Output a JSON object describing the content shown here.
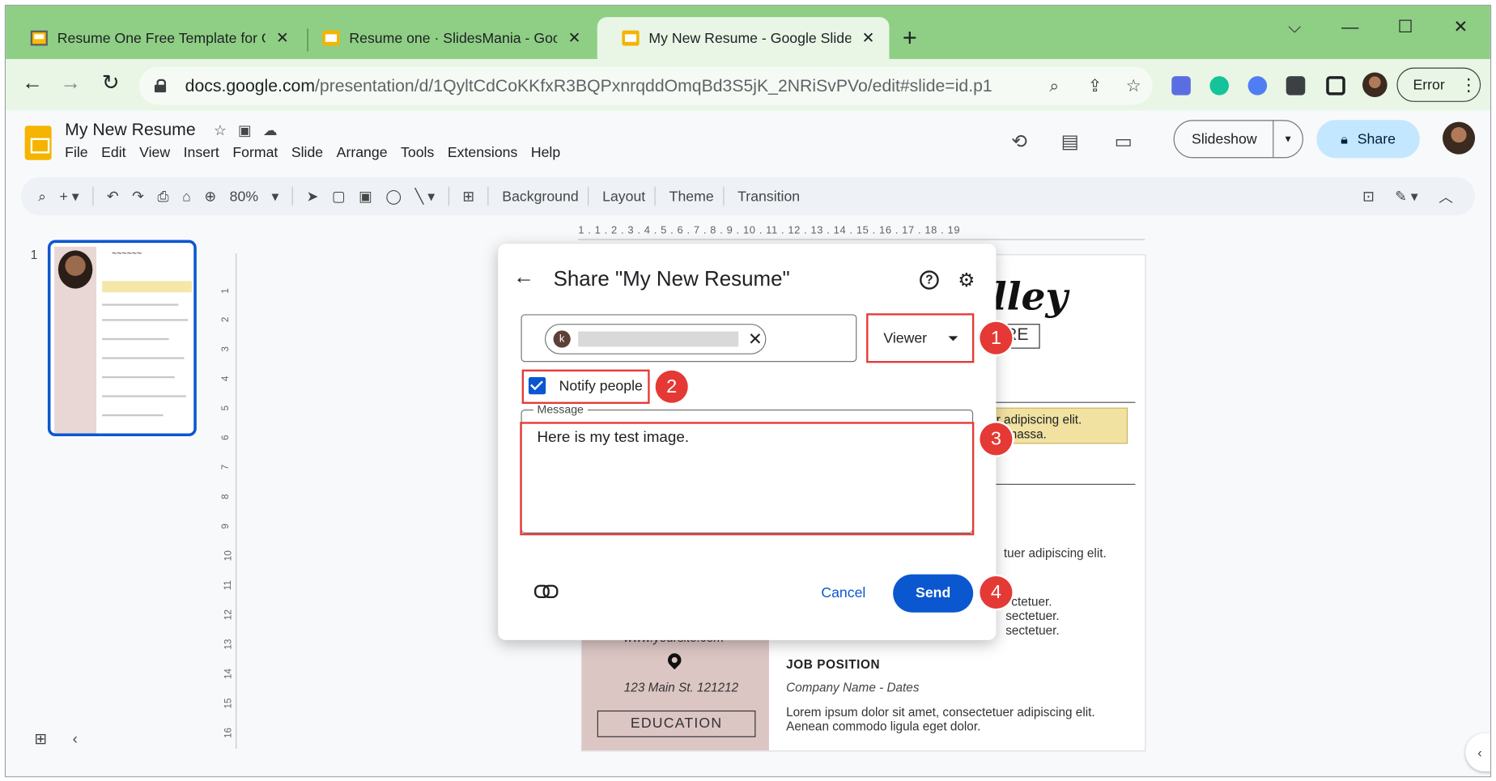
{
  "browser": {
    "tabs": [
      {
        "title": "Resume One Free Template for G",
        "close": "✕",
        "active": false
      },
      {
        "title": "Resume one · SlidesMania - Goo",
        "close": "✕",
        "active": false
      },
      {
        "title": "My New Resume - Google Slides",
        "close": "✕",
        "active": true
      }
    ],
    "new_tab": "+",
    "window_controls": {
      "dropdown": "⌵",
      "minimize": "—",
      "maximize": "☐",
      "close": "✕"
    },
    "nav": {
      "back": "←",
      "forward": "→",
      "reload": "↻"
    },
    "url_host": "docs.google.com",
    "url_path": "/presentation/d/1QyltCdCoKKfxR3BQPxnrqddOmqBd3S5jK_2NRiSvPVo/edit#slide=id.p1",
    "profile_status": "Error"
  },
  "app": {
    "title": "My New Resume",
    "menu": [
      "File",
      "Edit",
      "View",
      "Insert",
      "Format",
      "Slide",
      "Arrange",
      "Tools",
      "Extensions",
      "Help"
    ],
    "slideshow_label": "Slideshow",
    "share_label": "Share",
    "zoom": "80%",
    "toolbar_labels": [
      "Background",
      "Layout",
      "Theme",
      "Transition"
    ],
    "slide_number": "1"
  },
  "ruler": {
    "top": "1 . 1 . 2 . 3 . 4 . 5 . 6 . 7 . 8 . 9 . 10 . 11 . 12 . 13 . 14 . 15 . 16 . 17 . 18 . 19",
    "left": [
      "1",
      "2",
      "3",
      "4",
      "5",
      "6",
      "7",
      "8",
      "9",
      "10",
      "11",
      "12",
      "13",
      "14",
      "15",
      "16"
    ]
  },
  "slide": {
    "sig_partial": "lley",
    "title_box_partial": "RE",
    "quote_line1": "er adipiscing elit.",
    "quote_line2": "an massa.",
    "text_a": "tuer adipiscing elit.",
    "text_b1": "ctetuer.",
    "text_b2": "sectetuer.",
    "text_b3": "sectetuer.",
    "website": "www.yoursite.com",
    "address": "123 Main St. 121212",
    "education": "EDUCATION",
    "job_heading": "JOB POSITION",
    "job_sub": "Company Name - Dates",
    "job_para_1": "Lorem ipsum dolor sit amet, consectetuer adipiscing elit.",
    "job_para_2": "Aenean commodo ligula eget dolor."
  },
  "dialog": {
    "title": "Share \"My New Resume\"",
    "help": "?",
    "recipient_initial": "k",
    "chip_remove": "✕",
    "role": "Viewer",
    "notify_label": "Notify people",
    "notify_checked": true,
    "message_label": "Message",
    "message_value": "Here is my test image.",
    "cancel_label": "Cancel",
    "send_label": "Send"
  },
  "annotations": {
    "badges": [
      "1",
      "2",
      "3",
      "4"
    ],
    "color": "#e53935"
  },
  "colors": {
    "tabstrip": "#8fcf85",
    "primary_button": "#0b57d0",
    "share_button": "#c2e7ff"
  }
}
